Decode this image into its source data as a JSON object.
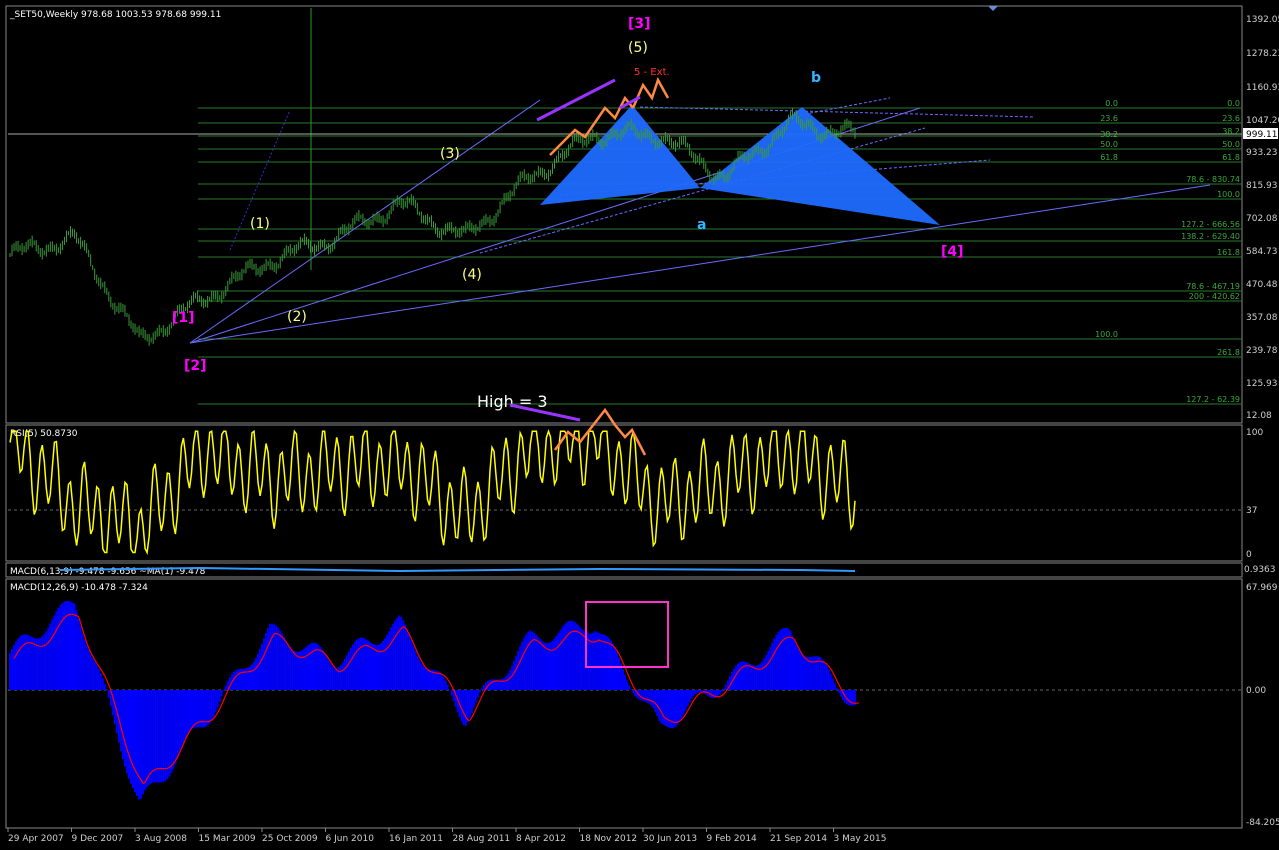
{
  "main": {
    "title": "_SET50,Weekly  978.68 1003.53 978.68 999.11",
    "price_axis": [
      "1392.05",
      "1278.23",
      "1160.93",
      "1047.20",
      "933.23",
      "815.93",
      "702.08",
      "584.73",
      "470.48",
      "357.08",
      "239.78",
      "125.93",
      "12.08"
    ],
    "current_price": "999.11",
    "fib_left": [
      "0.0",
      "23.6",
      "38.2",
      "50.0",
      "61.8",
      "78.6 - 830.74",
      "100.0",
      "127.2 - 666.56",
      "138.2 - 629.40",
      "161.8"
    ],
    "fib_right": [
      "0.0",
      "23.6",
      "38.2",
      "50.0",
      "61.8",
      "78.6 - 467.19",
      "200 - 420.62",
      "100.0",
      "261.8",
      "127.2 - 62.39"
    ],
    "annotations": [
      "[3]",
      "(5)",
      "5 - Ext.",
      "b",
      "[1]",
      "[2]",
      "[4]",
      "a",
      "(1)",
      "(2)",
      "(3)",
      "(4)",
      "High = 3"
    ]
  },
  "rsi": {
    "title": "RSI(5) 50.8730",
    "axis": [
      "100",
      "37",
      "0"
    ]
  },
  "macd_small": {
    "title": "MACD(6,13,9) -9.478 -9.656 ~MA(1) -9.478",
    "axis": "0.9363"
  },
  "macd": {
    "title": "MACD(12,26,9) -10.478 -7.324",
    "axis": [
      "67.969",
      "0.00",
      "-84.205"
    ]
  },
  "time_axis": [
    "29 Apr 2007",
    "9 Dec 2007",
    "3 Aug 2008",
    "15 Mar 2009",
    "25 Oct 2009",
    "6 Jun 2010",
    "16 Jan 2011",
    "28 Aug 2011",
    "8 Apr 2012",
    "18 Nov 2012",
    "30 Jun 2013",
    "9 Feb 2014",
    "21 Sep 2014",
    "3 May 2015"
  ],
  "colors": {
    "bars": "#3a9a3a",
    "rsi": "#ffff00",
    "macd_hist": "#0000ff",
    "macd_signal": "#ff0000",
    "fib": "#2a7a2a",
    "trend": "#6b6bff",
    "pattern": "#1f6bff",
    "magenta": "#ff00ff",
    "orange": "#ff8844"
  },
  "chart_data": [
    {
      "type": "line",
      "title": "_SET50,Weekly",
      "ylim": [
        12.08,
        1392.05
      ],
      "x": [
        "29 Apr 2007",
        "9 Dec 2007",
        "3 Aug 2008",
        "15 Mar 2009",
        "25 Oct 2009",
        "6 Jun 2010",
        "16 Jan 2011",
        "28 Aug 2011",
        "8 Apr 2012",
        "18 Nov 2012",
        "30 Jun 2013",
        "9 Feb 2014",
        "21 Sep 2014",
        "3 May 2015"
      ],
      "series": [
        {
          "values": [
            580,
            640,
            280,
            430,
            560,
            640,
            760,
            640,
            850,
            1000,
            1000,
            850,
            1040,
            999
          ]
        }
      ]
    },
    {
      "type": "line",
      "title": "RSI(5) 50.8730",
      "ylim": [
        0,
        100
      ],
      "x": [
        "29 Apr 2007",
        "9 Dec 2007",
        "3 Aug 2008",
        "15 Mar 2009",
        "25 Oct 2009",
        "6 Jun 2010",
        "16 Jan 2011",
        "28 Aug 2011",
        "8 Apr 2012",
        "18 Nov 2012",
        "30 Jun 2013",
        "9 Feb 2014",
        "21 Sep 2014",
        "3 May 2015"
      ],
      "series": [
        {
          "values": [
            90,
            40,
            20,
            85,
            60,
            70,
            75,
            30,
            85,
            95,
            40,
            60,
            85,
            51
          ]
        }
      ]
    },
    {
      "type": "bar",
      "title": "MACD(12,26,9) -10.478 -7.324",
      "ylim": [
        -84.205,
        67.969
      ],
      "x": [
        "29 Apr 2007",
        "9 Dec 2007",
        "3 Aug 2008",
        "15 Mar 2009",
        "25 Oct 2009",
        "6 Jun 2010",
        "16 Jan 2011",
        "28 Aug 2011",
        "8 Apr 2012",
        "18 Nov 2012",
        "30 Jun 2013",
        "9 Feb 2014",
        "21 Sep 2014",
        "3 May 2015"
      ],
      "series": [
        {
          "values": [
            25,
            60,
            -75,
            -20,
            40,
            20,
            45,
            -18,
            35,
            45,
            -25,
            5,
            40,
            -10
          ]
        }
      ]
    }
  ]
}
